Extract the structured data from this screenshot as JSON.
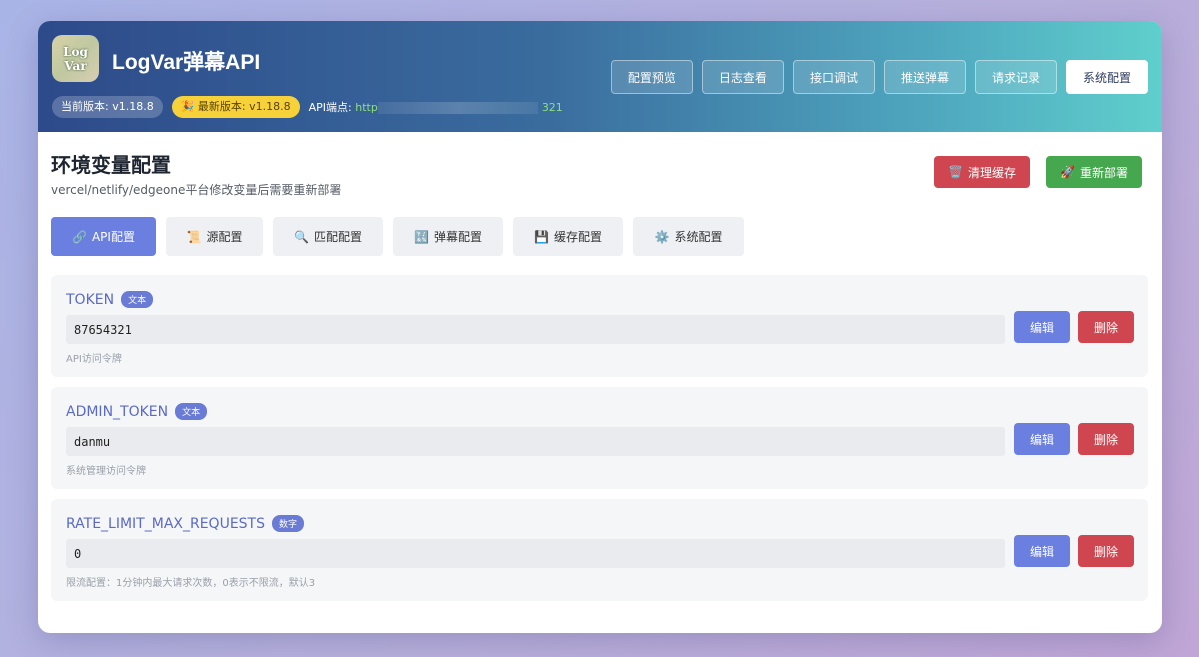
{
  "app": {
    "logo_lines": [
      "Log",
      "Var"
    ],
    "title": "LogVar弹幕API",
    "current_version": "当前版本: v1.18.8",
    "latest_version": "🎉 最新版本: v1.18.8",
    "api_label": "API端点: ",
    "api_url_prefix": "http",
    "api_url_suffix": "321"
  },
  "nav": [
    {
      "label": "配置预览"
    },
    {
      "label": "日志查看"
    },
    {
      "label": "接口调试"
    },
    {
      "label": "推送弹幕"
    },
    {
      "label": "请求记录"
    },
    {
      "label": "系统配置",
      "active": true
    }
  ],
  "page": {
    "title": "环境变量配置",
    "subtitle": "vercel/netlify/edgeone平台修改变量后需要重新部署",
    "clear_cache": "清理缓存",
    "clear_icon": "🗑️",
    "redeploy": "重新部署",
    "redeploy_icon": "🚀"
  },
  "tabs": [
    {
      "icon": "🔗",
      "label": "API配置",
      "active": true
    },
    {
      "icon": "📜",
      "label": "源配置"
    },
    {
      "icon": "🔍",
      "label": "匹配配置"
    },
    {
      "icon": "🔣",
      "label": "弹幕配置"
    },
    {
      "icon": "💾",
      "label": "缓存配置"
    },
    {
      "icon": "⚙️",
      "label": "系统配置"
    }
  ],
  "vars": [
    {
      "name": "TOKEN",
      "type": "文本",
      "value": "87654321",
      "desc": "API访问令牌",
      "edit": "编辑",
      "delete": "删除"
    },
    {
      "name": "ADMIN_TOKEN",
      "type": "文本",
      "value": "danmu",
      "desc": "系统管理访问令牌",
      "edit": "编辑",
      "delete": "删除"
    },
    {
      "name": "RATE_LIMIT_MAX_REQUESTS",
      "type": "数字",
      "value": "0",
      "desc": "限流配置：1分钟内最大请求次数，0表示不限流，默认3",
      "edit": "编辑",
      "delete": "删除"
    }
  ],
  "colors": {
    "accent": "#6a7fe0",
    "danger": "#cf4650",
    "success": "#45a84e",
    "badge_yellow": "#f7d13a"
  }
}
